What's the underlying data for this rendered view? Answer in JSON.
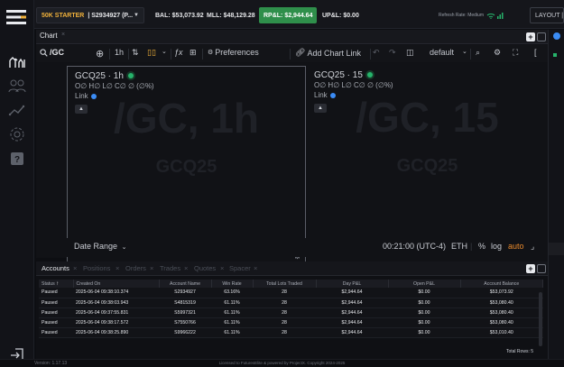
{
  "topbar": {
    "account_name": "50K STARTER",
    "account_id": "| S2934927 (P...",
    "bal": "BAL: $53,073.92",
    "mll": "MLL: $48,129.28",
    "rpnl": "RP&L: $2,944.64",
    "upnl": "UP&L: $0.00",
    "refresh_rate": "Refresh Rate: Medium",
    "layout_label": "LAYOUT |"
  },
  "chart_panel": {
    "tab_label": "Chart",
    "symbol": "/GC",
    "interval": "1h",
    "preferences": "Preferences",
    "add_chart_link": "Add Chart Link",
    "layout_default": "default",
    "panes": [
      {
        "title": "GCQ25 · 1h",
        "ohlc": "O∅ H∅ L∅ C∅ ∅ (∅%)",
        "link": "Link",
        "watermark_big": "/GC, 1h",
        "watermark_small": "GCQ25"
      },
      {
        "title": "GCQ25 · 15",
        "ohlc": "O∅ H∅ L∅ C∅ ∅ (∅%)",
        "link": "Link",
        "watermark_big": "/GC, 15",
        "watermark_small": "GCQ25"
      }
    ],
    "date_range": "Date Range",
    "time_readout": "00:21:00 (UTC-4)",
    "tz_symbol": "ETH",
    "percent": "%",
    "log": "log",
    "auto": "auto"
  },
  "accounts_panel": {
    "tabs": [
      {
        "label": "Accounts",
        "active": true
      },
      {
        "label": "Positions",
        "active": false
      },
      {
        "label": "Orders",
        "active": false
      },
      {
        "label": "Trades",
        "active": false
      },
      {
        "label": "Quotes",
        "active": false
      },
      {
        "label": "Spacer",
        "active": false
      }
    ],
    "columns": [
      "Status",
      "Created On",
      "Account Name",
      "Win Rate",
      "Total Lots Traded",
      "Day P&L",
      "Open P&L",
      "Account Balance"
    ],
    "rows": [
      [
        "Paused",
        "2025-06-04 09:38:10.374",
        "S2934927",
        "63.16%",
        "28",
        "$2,944.64",
        "$0.00",
        "$53,073.92"
      ],
      [
        "Paused",
        "2025-06-04 09:38:03.943",
        "S4815319",
        "61.11%",
        "28",
        "$2,944.64",
        "$0.00",
        "$53,080.40"
      ],
      [
        "Paused",
        "2025-06-04 09:37:55.831",
        "S5997321",
        "61.11%",
        "28",
        "$2,944.64",
        "$0.00",
        "$53,080.40"
      ],
      [
        "Paused",
        "2025-06-04 09:38:17.572",
        "S7550766",
        "61.11%",
        "28",
        "$2,944.64",
        "$0.00",
        "$53,080.40"
      ],
      [
        "Paused",
        "2025-06-04 09:38:25.890",
        "S9966222",
        "61.11%",
        "28",
        "$2,944.64",
        "$0.00",
        "$53,010.40"
      ]
    ],
    "total_rows": "Total Rows: 5"
  },
  "footer": {
    "version": "Version: 1.17.13",
    "license": "Licensed to FuturesElite & powered by ProjectX. Copyright 2024-2025"
  },
  "colors": {
    "accent_orange": "#f0b13a",
    "green": "#2f8f4b",
    "blue": "#3b8cf5",
    "auto_orange": "#e8892c"
  }
}
